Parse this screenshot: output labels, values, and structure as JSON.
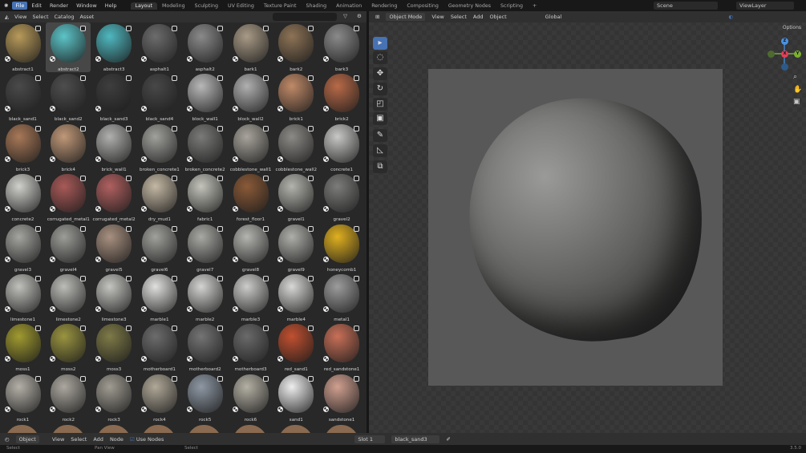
{
  "topbar": {
    "menus": [
      "File",
      "Edit",
      "Render",
      "Window",
      "Help"
    ],
    "workspaces": [
      "Layout",
      "Modeling",
      "Sculpting",
      "UV Editing",
      "Texture Paint",
      "Shading",
      "Animation",
      "Rendering",
      "Compositing",
      "Geometry Nodes",
      "Scripting",
      "+"
    ],
    "scene": "Scene",
    "view_layer": "ViewLayer"
  },
  "asset_browser": {
    "menus": [
      "View",
      "Select",
      "Catalog",
      "Asset"
    ],
    "search_placeholder": "",
    "selected": "abstract2",
    "assets": [
      {
        "name": "abstract1",
        "color": "#b89a5a"
      },
      {
        "name": "abstract2",
        "color": "#5cc4c8"
      },
      {
        "name": "abstract3",
        "color": "#4fb8c0"
      },
      {
        "name": "asphalt1",
        "color": "#6c6c6c"
      },
      {
        "name": "asphalt2",
        "color": "#8a8a8a"
      },
      {
        "name": "bark1",
        "color": "#a89a86"
      },
      {
        "name": "bark2",
        "color": "#8d7356"
      },
      {
        "name": "bark3",
        "color": "#8a8a8a"
      },
      {
        "name": "black_sand1",
        "color": "#4a4a4a"
      },
      {
        "name": "black_sand2",
        "color": "#4e4e4e"
      },
      {
        "name": "black_sand3",
        "color": "#3e3e3e"
      },
      {
        "name": "black_sand4",
        "color": "#484848"
      },
      {
        "name": "block_wall1",
        "color": "#b8b8b8"
      },
      {
        "name": "block_wall2",
        "color": "#b0b0b0"
      },
      {
        "name": "brick1",
        "color": "#c08a68"
      },
      {
        "name": "brick2",
        "color": "#b86a48"
      },
      {
        "name": "brick3",
        "color": "#a87858"
      },
      {
        "name": "brick4",
        "color": "#c09878"
      },
      {
        "name": "brick_wall1",
        "color": "#b0b0ae"
      },
      {
        "name": "broken_concrete1",
        "color": "#a0a09c"
      },
      {
        "name": "broken_concrete2",
        "color": "#7a7a78"
      },
      {
        "name": "cobblestone_wall1",
        "color": "#a8a49c"
      },
      {
        "name": "cobblestone_wall2",
        "color": "#8c8a86"
      },
      {
        "name": "concrete1",
        "color": "#c8c8c6"
      },
      {
        "name": "concrete2",
        "color": "#d0d0cc"
      },
      {
        "name": "corrugated_metal1",
        "color": "#a85a58"
      },
      {
        "name": "corrugated_metal2",
        "color": "#b06060"
      },
      {
        "name": "dry_mud1",
        "color": "#c4b8a4"
      },
      {
        "name": "fabric1",
        "color": "#c4c4bc"
      },
      {
        "name": "forest_floor1",
        "color": "#8a5a38"
      },
      {
        "name": "gravel1",
        "color": "#b4b4ae"
      },
      {
        "name": "gravel2",
        "color": "#7c7c7a"
      },
      {
        "name": "gravel3",
        "color": "#a4a4a0"
      },
      {
        "name": "gravel4",
        "color": "#9c9c98"
      },
      {
        "name": "gravel5",
        "color": "#a89080"
      },
      {
        "name": "gravel6",
        "color": "#a0a09c"
      },
      {
        "name": "gravel7",
        "color": "#a8a8a4"
      },
      {
        "name": "gravel8",
        "color": "#b4b4b0"
      },
      {
        "name": "gravel9",
        "color": "#aeaeaa"
      },
      {
        "name": "honeycomb1",
        "color": "#e0b020"
      },
      {
        "name": "limestone1",
        "color": "#c0c0bc"
      },
      {
        "name": "limestone2",
        "color": "#bcbcb8"
      },
      {
        "name": "limestone3",
        "color": "#c4c4c0"
      },
      {
        "name": "marble1",
        "color": "#e0e0de"
      },
      {
        "name": "marble2",
        "color": "#d4d4d2"
      },
      {
        "name": "marble3",
        "color": "#ccccca"
      },
      {
        "name": "marble4",
        "color": "#d8d8d6"
      },
      {
        "name": "metal1",
        "color": "#9c9c9c"
      },
      {
        "name": "moss1",
        "color": "#a09a30"
      },
      {
        "name": "moss2",
        "color": "#9a9440"
      },
      {
        "name": "moss3",
        "color": "#7e7a48"
      },
      {
        "name": "motherboard1",
        "color": "#6c6c6c"
      },
      {
        "name": "motherboard2",
        "color": "#747474"
      },
      {
        "name": "motherboard3",
        "color": "#6a6a6a"
      },
      {
        "name": "red_sand1",
        "color": "#c05030"
      },
      {
        "name": "red_sandstone1",
        "color": "#c87058"
      },
      {
        "name": "rock1",
        "color": "#b4b0a8"
      },
      {
        "name": "rock2",
        "color": "#aca8a0"
      },
      {
        "name": "rock3",
        "color": "#a09c92"
      },
      {
        "name": "rock4",
        "color": "#b0a898"
      },
      {
        "name": "rock5",
        "color": "#8e98a4"
      },
      {
        "name": "rock6",
        "color": "#b4b0a4"
      },
      {
        "name": "sand1",
        "color": "#eeeeee"
      },
      {
        "name": "sandstone1",
        "color": "#d0a090"
      }
    ]
  },
  "viewport": {
    "mode": "Object Mode",
    "menus": [
      "View",
      "Select",
      "Add",
      "Object"
    ],
    "orientation": "Global",
    "options": "Options",
    "axes": [
      "X",
      "Y",
      "Z"
    ]
  },
  "node_editor": {
    "editor": "Object",
    "menus": [
      "View",
      "Select",
      "Add",
      "Node"
    ],
    "use_nodes": "Use Nodes",
    "slot": "Slot 1",
    "material": "black_sand3"
  },
  "status": {
    "items": [
      "Select",
      "Pan View",
      "Select"
    ],
    "version": "3.5.0"
  }
}
